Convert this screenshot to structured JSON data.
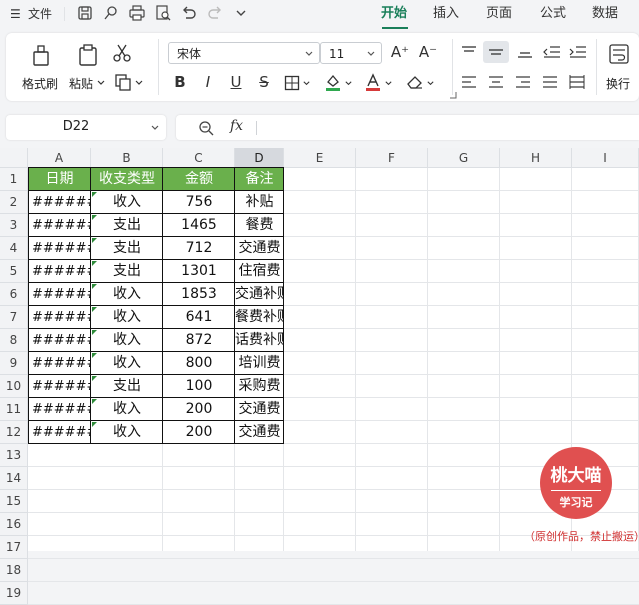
{
  "topbar": {
    "menu_file": "文件",
    "tabs": [
      {
        "label": "开始",
        "active": true
      },
      {
        "label": "插入",
        "active": false
      },
      {
        "label": "页面",
        "active": false
      },
      {
        "label": "公式",
        "active": false
      },
      {
        "label": "数据",
        "active": false
      }
    ]
  },
  "ribbon": {
    "format_painter": "格式刷",
    "paste": "粘贴",
    "font_name": "宋体",
    "font_size": "11",
    "wrap_text": "换行"
  },
  "formula_bar": {
    "name_box": "D22",
    "fx_label": "fx",
    "formula": ""
  },
  "sheet": {
    "columns": [
      "A",
      "B",
      "C",
      "D",
      "E",
      "F",
      "G",
      "H",
      "I"
    ],
    "selected_column": "D",
    "rows": [
      "1",
      "2",
      "3",
      "4",
      "5",
      "6",
      "7",
      "8",
      "9",
      "10",
      "11",
      "12",
      "13",
      "14",
      "15",
      "16",
      "17",
      "18",
      "19"
    ],
    "header": [
      "日期",
      "收支类型",
      "金额",
      "备注"
    ],
    "data": [
      [
        "######",
        "收入",
        "756",
        "补贴"
      ],
      [
        "######",
        "支出",
        "1465",
        "餐费"
      ],
      [
        "######",
        "支出",
        "712",
        "交通费"
      ],
      [
        "######",
        "支出",
        "1301",
        "住宿费"
      ],
      [
        "######",
        "收入",
        "1853",
        "交通补贴"
      ],
      [
        "######",
        "收入",
        "641",
        "餐费补贴"
      ],
      [
        "######",
        "收入",
        "872",
        "话费补贴"
      ],
      [
        "######",
        "收入",
        "800",
        "培训费"
      ],
      [
        "######",
        "支出",
        "100",
        "采购费"
      ],
      [
        "######",
        "收入",
        "200",
        "交通费"
      ],
      [
        "######",
        "收入",
        "200",
        "交通费"
      ]
    ]
  },
  "watermark": {
    "line1": "桃大喵",
    "line2": "学习记",
    "caption": "（原创作品，禁止搬运）"
  },
  "colors": {
    "accent": "#1a7f5a",
    "header_fill": "#6ab04c",
    "watermark": "#e05050"
  }
}
